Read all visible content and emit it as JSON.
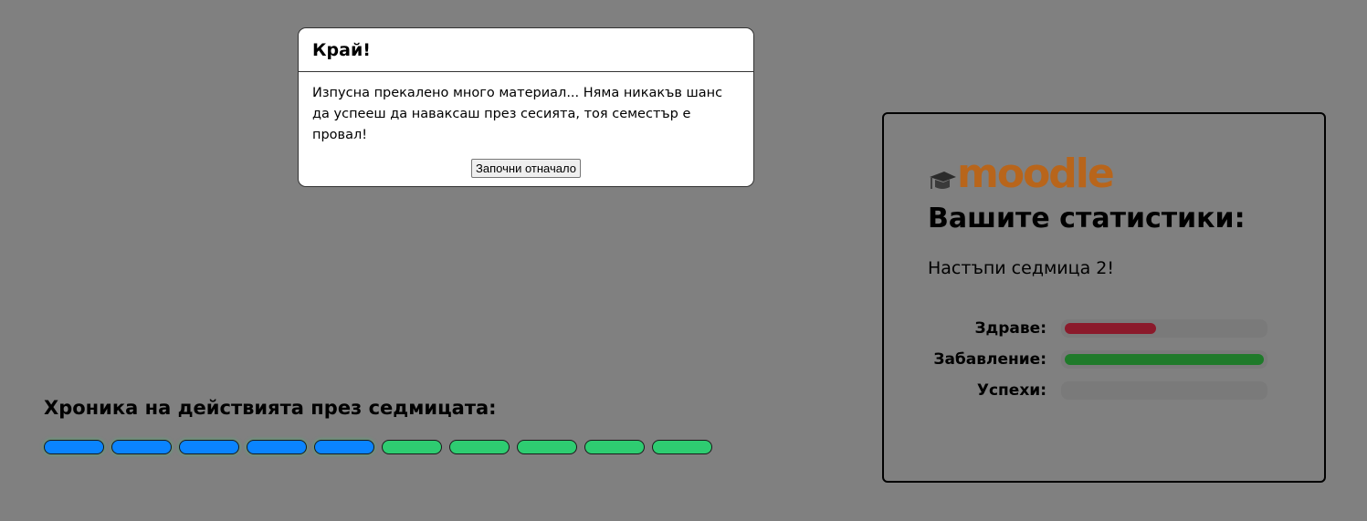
{
  "modal": {
    "title": "Край!",
    "message": "Изпусна прекалено много материал... Няма никакъв шанс да успееш да наваксаш през сесията, тоя семестър е провал!",
    "restart_label": "Започни отначало"
  },
  "timeline": {
    "title": "Хроника на действията през седмицата:",
    "items": [
      {
        "color": "#0a84ff"
      },
      {
        "color": "#0a84ff"
      },
      {
        "color": "#0a84ff"
      },
      {
        "color": "#0a84ff"
      },
      {
        "color": "#0a84ff"
      },
      {
        "color": "#2ecc71"
      },
      {
        "color": "#2ecc71"
      },
      {
        "color": "#2ecc71"
      },
      {
        "color": "#2ecc71"
      },
      {
        "color": "#2ecc71"
      }
    ]
  },
  "stats": {
    "logo_text": "moodle",
    "logo_icon": "graduation-cap-icon",
    "title": "Вашите статистики:",
    "week_text": "Настъпи седмица 2!",
    "meters": [
      {
        "label": "Здраве:",
        "value": 0.46,
        "color": "#8b1a2b"
      },
      {
        "label": "Забавление:",
        "value": 1.0,
        "color": "#1f7a2a"
      },
      {
        "label": "Успехи:",
        "value": 0.0,
        "color": "#1f7a2a"
      }
    ]
  },
  "colors": {
    "background": "#808080",
    "logo": "#b8651b"
  }
}
